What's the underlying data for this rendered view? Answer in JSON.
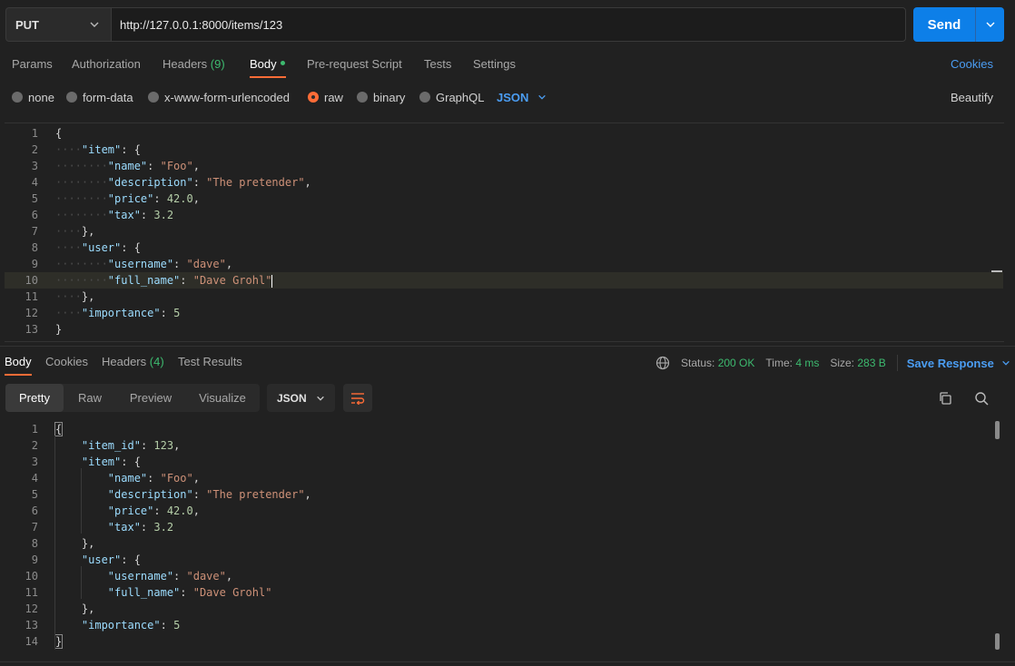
{
  "request": {
    "method": "PUT",
    "url": "http://127.0.0.1:8000/items/123",
    "send_label": "Send"
  },
  "request_tabs": {
    "params": "Params",
    "authorization": "Authorization",
    "headers": "Headers",
    "headers_count": "(9)",
    "body": "Body",
    "pre_request": "Pre-request Script",
    "tests": "Tests",
    "settings": "Settings",
    "cookies": "Cookies"
  },
  "body_types": {
    "none": "none",
    "form_data": "form-data",
    "urlencoded": "x-www-form-urlencoded",
    "raw": "raw",
    "binary": "binary",
    "graphql": "GraphQL",
    "format": "JSON",
    "beautify": "Beautify",
    "selected": "raw"
  },
  "request_body": {
    "line_numbers": [
      "1",
      "2",
      "3",
      "4",
      "5",
      "6",
      "7",
      "8",
      "9",
      "10",
      "11",
      "12",
      "13"
    ],
    "t": {
      "open": "{",
      "close": "}",
      "item_key": "\"item\"",
      "name_key": "\"name\"",
      "name_val": "\"Foo\"",
      "desc_key": "\"description\"",
      "desc_val": "\"The pretender\"",
      "price_key": "\"price\"",
      "price_val": "42.0",
      "tax_key": "\"tax\"",
      "tax_val": "3.2",
      "user_key": "\"user\"",
      "username_key": "\"username\"",
      "username_val": "\"dave\"",
      "fullname_key": "\"full_name\"",
      "fullname_val": "\"Dave Grohl\"",
      "importance_key": "\"importance\"",
      "importance_val": "5"
    }
  },
  "response_tabs": {
    "body": "Body",
    "cookies": "Cookies",
    "headers": "Headers",
    "headers_count": "(4)",
    "test_results": "Test Results"
  },
  "response_status": {
    "status_label": "Status:",
    "status_value": "200 OK",
    "time_label": "Time:",
    "time_value": "4 ms",
    "size_label": "Size:",
    "size_value": "283 B",
    "save_response": "Save Response"
  },
  "response_format": {
    "pretty": "Pretty",
    "raw": "Raw",
    "preview": "Preview",
    "visualize": "Visualize",
    "format": "JSON"
  },
  "response_body": {
    "line_numbers": [
      "1",
      "2",
      "3",
      "4",
      "5",
      "6",
      "7",
      "8",
      "9",
      "10",
      "11",
      "12",
      "13",
      "14"
    ],
    "t": {
      "open": "{",
      "close": "}",
      "item_id_key": "\"item_id\"",
      "item_id_val": "123",
      "item_key": "\"item\"",
      "name_key": "\"name\"",
      "name_val": "\"Foo\"",
      "desc_key": "\"description\"",
      "desc_val": "\"The pretender\"",
      "price_key": "\"price\"",
      "price_val": "42.0",
      "tax_key": "\"tax\"",
      "tax_val": "3.2",
      "user_key": "\"user\"",
      "username_key": "\"username\"",
      "username_val": "\"dave\"",
      "fullname_key": "\"full_name\"",
      "fullname_val": "\"Dave Grohl\"",
      "importance_key": "\"importance\"",
      "importance_val": "5"
    }
  },
  "colors": {
    "accent": "#ff6c37",
    "primary": "#0d7fe8",
    "success": "#3dba6f",
    "link": "#4b9df2"
  },
  "icons": [
    "chevron-down-icon",
    "globe-icon",
    "copy-icon",
    "search-icon",
    "wrap-lines-icon"
  ]
}
